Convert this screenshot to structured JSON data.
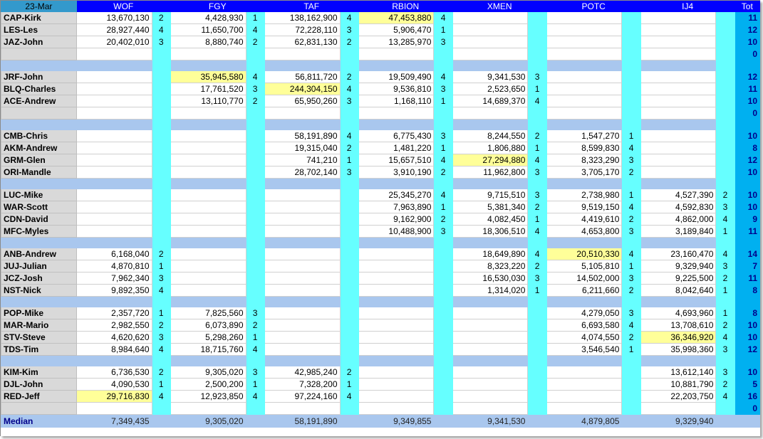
{
  "header": {
    "date": "23-Mar",
    "columns": [
      "WOF",
      "FGY",
      "TAF",
      "RBION",
      "XMEN",
      "POTC",
      "IJ4"
    ],
    "total": "Tot"
  },
  "colors": {
    "header_blue": "#0000ff",
    "count_cyan": "#66ffff",
    "total_blue": "#00b0f0",
    "separator": "#a9c7ee",
    "highlight": "#ffff99"
  },
  "groups": [
    [
      {
        "name": "CAP-Kirk",
        "cells": [
          [
            "13,670,130",
            "2"
          ],
          [
            "4,428,930",
            "1"
          ],
          [
            "138,162,900",
            "4"
          ],
          [
            "47,453,880",
            "4"
          ],
          [
            "",
            ""
          ],
          [
            "",
            ""
          ],
          [
            "",
            ""
          ]
        ],
        "tot": "11",
        "hl": [
          3
        ]
      },
      {
        "name": "LES-Les",
        "cells": [
          [
            "28,927,440",
            "4"
          ],
          [
            "11,650,700",
            "4"
          ],
          [
            "72,228,110",
            "3"
          ],
          [
            "5,906,470",
            "1"
          ],
          [
            "",
            ""
          ],
          [
            "",
            ""
          ],
          [
            "",
            ""
          ]
        ],
        "tot": "12",
        "hl": []
      },
      {
        "name": "JAZ-John",
        "cells": [
          [
            "20,402,010",
            "3"
          ],
          [
            "8,880,740",
            "2"
          ],
          [
            "62,831,130",
            "2"
          ],
          [
            "13,285,970",
            "3"
          ],
          [
            "",
            ""
          ],
          [
            "",
            ""
          ],
          [
            "",
            ""
          ]
        ],
        "tot": "10",
        "hl": []
      },
      {
        "name": "",
        "cells": [
          [
            "",
            ""
          ],
          [
            "",
            ""
          ],
          [
            "",
            ""
          ],
          [
            "",
            ""
          ],
          [
            "",
            ""
          ],
          [
            "",
            ""
          ],
          [
            "",
            ""
          ]
        ],
        "tot": "0",
        "hl": []
      }
    ],
    [
      {
        "name": "JRF-John",
        "cells": [
          [
            "",
            ""
          ],
          [
            "35,945,580",
            "4"
          ],
          [
            "56,811,720",
            "2"
          ],
          [
            "19,509,490",
            "4"
          ],
          [
            "9,341,530",
            "3"
          ],
          [
            "",
            ""
          ],
          [
            "",
            ""
          ]
        ],
        "tot": "12",
        "hl": [
          1
        ]
      },
      {
        "name": "BLQ-Charles",
        "cells": [
          [
            "",
            ""
          ],
          [
            "17,761,520",
            "3"
          ],
          [
            "244,304,150",
            "4"
          ],
          [
            "9,536,810",
            "3"
          ],
          [
            "2,523,650",
            "1"
          ],
          [
            "",
            ""
          ],
          [
            "",
            ""
          ]
        ],
        "tot": "11",
        "hl": [
          2
        ]
      },
      {
        "name": "ACE-Andrew",
        "cells": [
          [
            "",
            ""
          ],
          [
            "13,110,770",
            "2"
          ],
          [
            "65,950,260",
            "3"
          ],
          [
            "1,168,110",
            "1"
          ],
          [
            "14,689,370",
            "4"
          ],
          [
            "",
            ""
          ],
          [
            "",
            ""
          ]
        ],
        "tot": "10",
        "hl": []
      },
      {
        "name": "",
        "cells": [
          [
            "",
            ""
          ],
          [
            "",
            ""
          ],
          [
            "",
            ""
          ],
          [
            "",
            ""
          ],
          [
            "",
            ""
          ],
          [
            "",
            ""
          ],
          [
            "",
            ""
          ]
        ],
        "tot": "0",
        "hl": []
      }
    ],
    [
      {
        "name": "CMB-Chris",
        "cells": [
          [
            "",
            ""
          ],
          [
            "",
            ""
          ],
          [
            "58,191,890",
            "4"
          ],
          [
            "6,775,430",
            "3"
          ],
          [
            "8,244,550",
            "2"
          ],
          [
            "1,547,270",
            "1"
          ],
          [
            "",
            ""
          ]
        ],
        "tot": "10",
        "hl": []
      },
      {
        "name": "AKM-Andrew",
        "cells": [
          [
            "",
            ""
          ],
          [
            "",
            ""
          ],
          [
            "19,315,040",
            "2"
          ],
          [
            "1,481,220",
            "1"
          ],
          [
            "1,806,880",
            "1"
          ],
          [
            "8,599,830",
            "4"
          ],
          [
            "",
            ""
          ]
        ],
        "tot": "8",
        "hl": []
      },
      {
        "name": "GRM-Glen",
        "cells": [
          [
            "",
            ""
          ],
          [
            "",
            ""
          ],
          [
            "741,210",
            "1"
          ],
          [
            "15,657,510",
            "4"
          ],
          [
            "27,294,880",
            "4"
          ],
          [
            "8,323,290",
            "3"
          ],
          [
            "",
            ""
          ]
        ],
        "tot": "12",
        "hl": [
          4
        ]
      },
      {
        "name": "ORI-Mandle",
        "cells": [
          [
            "",
            ""
          ],
          [
            "",
            ""
          ],
          [
            "28,702,140",
            "3"
          ],
          [
            "3,910,190",
            "2"
          ],
          [
            "11,962,800",
            "3"
          ],
          [
            "3,705,170",
            "2"
          ],
          [
            "",
            ""
          ]
        ],
        "tot": "10",
        "hl": []
      }
    ],
    [
      {
        "name": "LUC-Mike",
        "cells": [
          [
            "",
            ""
          ],
          [
            "",
            ""
          ],
          [
            "",
            ""
          ],
          [
            "25,345,270",
            "4"
          ],
          [
            "9,715,510",
            "3"
          ],
          [
            "2,738,980",
            "1"
          ],
          [
            "4,527,390",
            "2"
          ]
        ],
        "tot": "10",
        "hl": []
      },
      {
        "name": "WAR-Scott",
        "cells": [
          [
            "",
            ""
          ],
          [
            "",
            ""
          ],
          [
            "",
            ""
          ],
          [
            "7,963,890",
            "1"
          ],
          [
            "5,381,340",
            "2"
          ],
          [
            "9,519,150",
            "4"
          ],
          [
            "4,592,830",
            "3"
          ]
        ],
        "tot": "10",
        "hl": []
      },
      {
        "name": "CDN-David",
        "cells": [
          [
            "",
            ""
          ],
          [
            "",
            ""
          ],
          [
            "",
            ""
          ],
          [
            "9,162,900",
            "2"
          ],
          [
            "4,082,450",
            "1"
          ],
          [
            "4,419,610",
            "2"
          ],
          [
            "4,862,000",
            "4"
          ]
        ],
        "tot": "9",
        "hl": []
      },
      {
        "name": "MFC-Myles",
        "cells": [
          [
            "",
            ""
          ],
          [
            "",
            ""
          ],
          [
            "",
            ""
          ],
          [
            "10,488,900",
            "3"
          ],
          [
            "18,306,510",
            "4"
          ],
          [
            "4,653,800",
            "3"
          ],
          [
            "3,189,840",
            "1"
          ]
        ],
        "tot": "11",
        "hl": []
      }
    ],
    [
      {
        "name": "ANB-Andrew",
        "cells": [
          [
            "6,168,040",
            "2"
          ],
          [
            "",
            ""
          ],
          [
            "",
            ""
          ],
          [
            "",
            ""
          ],
          [
            "18,649,890",
            "4"
          ],
          [
            "20,510,330",
            "4"
          ],
          [
            "23,160,470",
            "4"
          ]
        ],
        "tot": "14",
        "hl": [
          5
        ]
      },
      {
        "name": "JUJ-Julian",
        "cells": [
          [
            "4,870,810",
            "1"
          ],
          [
            "",
            ""
          ],
          [
            "",
            ""
          ],
          [
            "",
            ""
          ],
          [
            "8,323,220",
            "2"
          ],
          [
            "5,105,810",
            "1"
          ],
          [
            "9,329,940",
            "3"
          ]
        ],
        "tot": "7",
        "hl": []
      },
      {
        "name": "JCZ-Josh",
        "cells": [
          [
            "7,962,340",
            "3"
          ],
          [
            "",
            ""
          ],
          [
            "",
            ""
          ],
          [
            "",
            ""
          ],
          [
            "16,530,030",
            "3"
          ],
          [
            "14,502,000",
            "3"
          ],
          [
            "9,225,500",
            "2"
          ]
        ],
        "tot": "11",
        "hl": []
      },
      {
        "name": "NST-Nick",
        "cells": [
          [
            "9,892,350",
            "4"
          ],
          [
            "",
            ""
          ],
          [
            "",
            ""
          ],
          [
            "",
            ""
          ],
          [
            "1,314,020",
            "1"
          ],
          [
            "6,211,660",
            "2"
          ],
          [
            "8,042,640",
            "1"
          ]
        ],
        "tot": "8",
        "hl": []
      }
    ],
    [
      {
        "name": "POP-Mike",
        "cells": [
          [
            "2,357,720",
            "1"
          ],
          [
            "7,825,560",
            "3"
          ],
          [
            "",
            ""
          ],
          [
            "",
            ""
          ],
          [
            "",
            ""
          ],
          [
            "4,279,050",
            "3"
          ],
          [
            "4,693,960",
            "1"
          ]
        ],
        "tot": "8",
        "hl": []
      },
      {
        "name": "MAR-Mario",
        "cells": [
          [
            "2,982,550",
            "2"
          ],
          [
            "6,073,890",
            "2"
          ],
          [
            "",
            ""
          ],
          [
            "",
            ""
          ],
          [
            "",
            ""
          ],
          [
            "6,693,580",
            "4"
          ],
          [
            "13,708,610",
            "2"
          ]
        ],
        "tot": "10",
        "hl": []
      },
      {
        "name": "STV-Steve",
        "cells": [
          [
            "4,620,620",
            "3"
          ],
          [
            "5,298,260",
            "1"
          ],
          [
            "",
            ""
          ],
          [
            "",
            ""
          ],
          [
            "",
            ""
          ],
          [
            "4,074,550",
            "2"
          ],
          [
            "36,346,920",
            "4"
          ]
        ],
        "tot": "10",
        "hl": [
          6
        ]
      },
      {
        "name": "TDS-Tim",
        "cells": [
          [
            "8,984,640",
            "4"
          ],
          [
            "18,715,760",
            "4"
          ],
          [
            "",
            ""
          ],
          [
            "",
            ""
          ],
          [
            "",
            ""
          ],
          [
            "3,546,540",
            "1"
          ],
          [
            "35,998,360",
            "3"
          ]
        ],
        "tot": "12",
        "hl": []
      }
    ],
    [
      {
        "name": "KIM-Kim",
        "cells": [
          [
            "6,736,530",
            "2"
          ],
          [
            "9,305,020",
            "3"
          ],
          [
            "42,985,240",
            "2"
          ],
          [
            "",
            ""
          ],
          [
            "",
            ""
          ],
          [
            "",
            ""
          ],
          [
            "13,612,140",
            "3"
          ]
        ],
        "tot": "10",
        "hl": []
      },
      {
        "name": "DJL-John",
        "cells": [
          [
            "4,090,530",
            "1"
          ],
          [
            "2,500,200",
            "1"
          ],
          [
            "7,328,200",
            "1"
          ],
          [
            "",
            ""
          ],
          [
            "",
            ""
          ],
          [
            "",
            ""
          ],
          [
            "10,881,790",
            "2"
          ]
        ],
        "tot": "5",
        "hl": []
      },
      {
        "name": "RED-Jeff",
        "cells": [
          [
            "29,716,830",
            "4"
          ],
          [
            "12,923,850",
            "4"
          ],
          [
            "97,224,160",
            "4"
          ],
          [
            "",
            ""
          ],
          [
            "",
            ""
          ],
          [
            "",
            ""
          ],
          [
            "22,203,750",
            "4"
          ]
        ],
        "tot": "16",
        "hl": [
          0
        ]
      },
      {
        "name": "",
        "cells": [
          [
            "",
            ""
          ],
          [
            "",
            ""
          ],
          [
            "",
            ""
          ],
          [
            "",
            ""
          ],
          [
            "",
            ""
          ],
          [
            "",
            ""
          ],
          [
            "",
            ""
          ]
        ],
        "tot": "0",
        "hl": []
      }
    ]
  ],
  "median": {
    "label": "Median",
    "values": [
      "7,349,435",
      "9,305,020",
      "58,191,890",
      "9,349,855",
      "9,341,530",
      "4,879,805",
      "9,329,940"
    ]
  }
}
